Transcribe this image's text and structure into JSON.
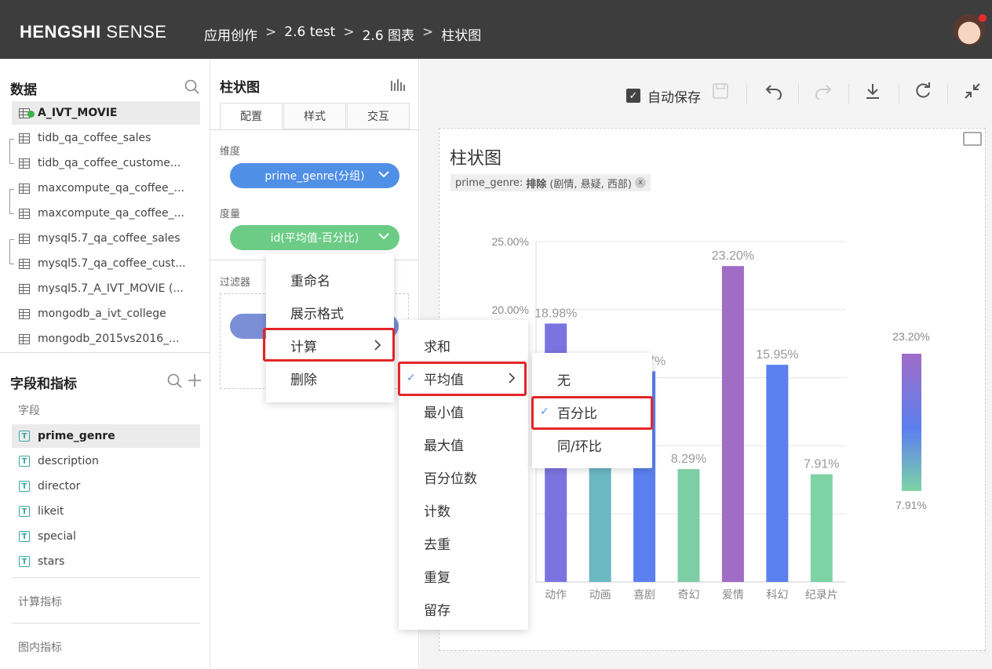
{
  "header": {
    "logo_bold": "HENGSHI",
    "logo_thin": " SENSE",
    "breadcrumbs": [
      "应用创作",
      "2.6 test",
      "2.6 图表",
      "柱状图"
    ],
    "sep": ">"
  },
  "data_panel": {
    "title": "数据",
    "datasets": [
      "A_IVT_MOVIE",
      "tidb_qa_coffee_sales",
      "tidb_qa_coffee_custome...",
      "maxcompute_qa_coffee_...",
      "maxcompute_qa_coffee_...",
      "mysql5.7_qa_coffee_sales",
      "mysql5.7_qa_coffee_cust...",
      "mysql5.7_A_IVT_MOVIE (...",
      "mongodb_a_ivt_college",
      "mongodb_2015vs2016_..."
    ]
  },
  "fields_panel": {
    "title": "字段和指标",
    "fields_label": "字段",
    "fields": [
      "prime_genre",
      "description",
      "director",
      "likeit",
      "special",
      "stars"
    ],
    "calc_metrics": "计算指标",
    "chart_metrics": "图内指标"
  },
  "config": {
    "title": "柱状图",
    "tabs": [
      "配置",
      "样式",
      "交互"
    ],
    "dimension_label": "维度",
    "dimension_pill": "prime_genre(分组)",
    "measure_label": "度量",
    "measure_pill": "id(平均值-百分比)",
    "filter_label": "过滤器"
  },
  "toolbar": {
    "autosave": "自动保存"
  },
  "context_menu": {
    "items": [
      "重命名",
      "展示格式",
      "计算",
      "删除"
    ]
  },
  "calc_menu": {
    "items": [
      "求和",
      "平均值",
      "最小值",
      "最大值",
      "百分位数",
      "计数",
      "去重",
      "重复",
      "留存"
    ],
    "checked": "平均值"
  },
  "avg_menu": {
    "items": [
      "无",
      "百分比",
      "同/环比"
    ],
    "checked": "百分比"
  },
  "chart": {
    "title": "柱状图",
    "filter_field": "prime_genre:",
    "filter_op": "排除",
    "filter_vals": "(剧情, 悬疑, 西部)",
    "filter_close": "x"
  },
  "chart_data": {
    "type": "bar",
    "categories": [
      "动作",
      "动画",
      "喜剧",
      "奇幻",
      "爱情",
      "科幻",
      "纪录片"
    ],
    "values": [
      18.98,
      15.2,
      15.47,
      8.29,
      23.2,
      15.95,
      7.91
    ],
    "value_labels": [
      "18.98%",
      "",
      "15.47%",
      "8.29%",
      "23.20%",
      "15.95%",
      "7.91%"
    ],
    "colors": [
      "#7b74e0",
      "#6bb7c2",
      "#5b7fef",
      "#7dcea5",
      "#a06cc6",
      "#5b7fef",
      "#7dd3a5"
    ],
    "yticks": [
      "25.00%",
      "20.00%"
    ],
    "ylim": [
      0,
      25
    ],
    "legend_max": "23.20%",
    "legend_min": "7.91%"
  }
}
